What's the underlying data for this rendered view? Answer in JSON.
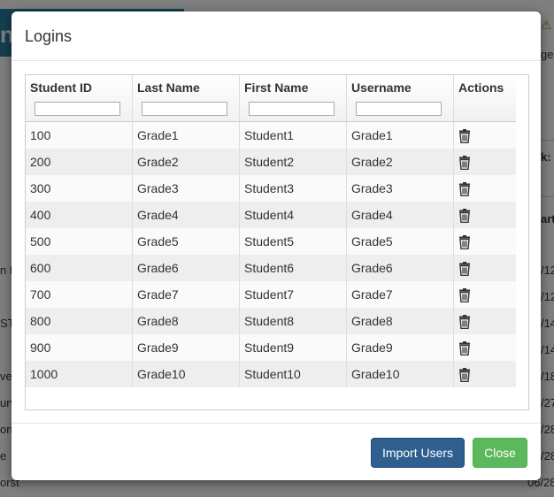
{
  "background": {
    "banner_text": "n",
    "right_snippets": [
      "⚠",
      "ge",
      "k:",
      "art"
    ],
    "dates": [
      "/12",
      "/12",
      "/14",
      "/14",
      "/18",
      "/27",
      "/28",
      "/28",
      "06/28"
    ],
    "left_snippets": [
      "n F",
      "ST",
      "ve",
      "urv",
      "on",
      "e",
      "orst"
    ]
  },
  "modal": {
    "title": "Logins",
    "table": {
      "columns": [
        "Student ID",
        "Last Name",
        "First Name",
        "Username",
        "Actions"
      ],
      "rows": [
        {
          "id": "100",
          "last": "Grade1",
          "first": "Student1",
          "username": "Grade1"
        },
        {
          "id": "200",
          "last": "Grade2",
          "first": "Student2",
          "username": "Grade2"
        },
        {
          "id": "300",
          "last": "Grade3",
          "first": "Student3",
          "username": "Grade3"
        },
        {
          "id": "400",
          "last": "Grade4",
          "first": "Student4",
          "username": "Grade4"
        },
        {
          "id": "500",
          "last": "Grade5",
          "first": "Student5",
          "username": "Grade5"
        },
        {
          "id": "600",
          "last": "Grade6",
          "first": "Student6",
          "username": "Grade6"
        },
        {
          "id": "700",
          "last": "Grade7",
          "first": "Student7",
          "username": "Grade7"
        },
        {
          "id": "800",
          "last": "Grade8",
          "first": "Student8",
          "username": "Grade8"
        },
        {
          "id": "900",
          "last": "Grade9",
          "first": "Student9",
          "username": "Grade9"
        },
        {
          "id": "1000",
          "last": "Grade10",
          "first": "Student10",
          "username": "Grade10"
        }
      ],
      "row_action_icon": "trash-icon"
    },
    "buttons": {
      "import": "Import Users",
      "close": "Close"
    },
    "colors": {
      "primary": "#2e5f8f",
      "success": "#5cb85c"
    }
  }
}
